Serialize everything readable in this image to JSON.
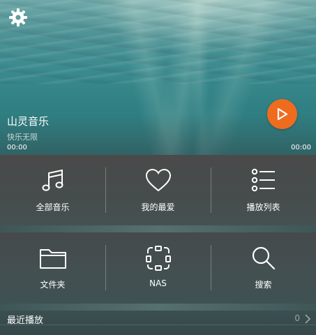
{
  "player": {
    "title": "山灵音乐",
    "subtitle": "快乐无限",
    "time_elapsed": "00:00",
    "time_total": "00:00",
    "settings_icon": "gear-icon",
    "play_icon": "play-icon",
    "accent_color": "#ef6c1f"
  },
  "library": {
    "row1": [
      {
        "label": "全部音乐",
        "icon": "music-note-icon"
      },
      {
        "label": "我的最爱",
        "icon": "heart-icon"
      },
      {
        "label": "播放列表",
        "icon": "playlist-icon"
      }
    ],
    "row2": [
      {
        "label": "文件夹",
        "icon": "folder-icon"
      },
      {
        "label": "NAS",
        "icon": "nas-icon"
      },
      {
        "label": "搜索",
        "icon": "search-icon"
      }
    ]
  },
  "recent": {
    "label": "最近播放",
    "count": "0",
    "chevron_icon": "chevron-right-icon"
  }
}
